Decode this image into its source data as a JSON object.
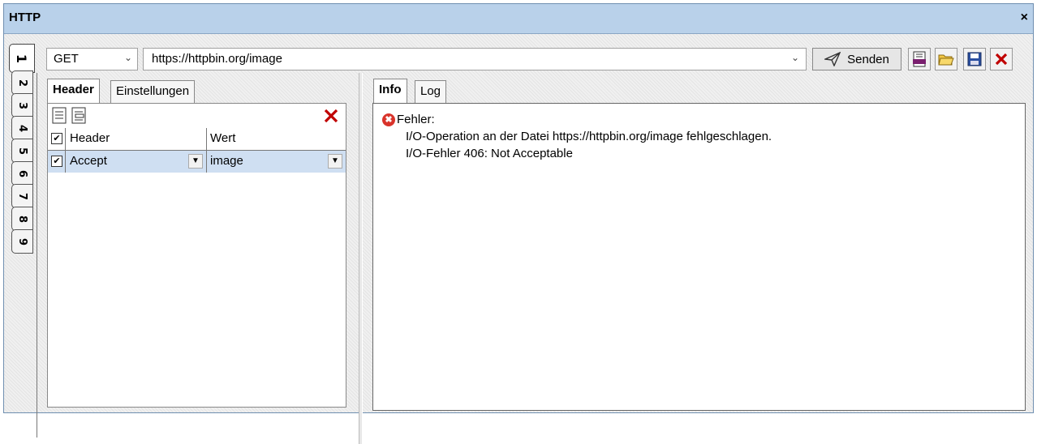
{
  "window": {
    "title": "HTTP",
    "close_glyph": "×"
  },
  "side_tabs": [
    "1",
    "2",
    "3",
    "4",
    "5",
    "6",
    "7",
    "8",
    "9"
  ],
  "request": {
    "method": "GET",
    "url": "https://httpbin.org/image",
    "send_label": "Senden"
  },
  "left_tabs": {
    "header": "Header",
    "settings": "Einstellungen"
  },
  "header_grid": {
    "columns": [
      "Header",
      "Wert"
    ],
    "rows": [
      {
        "checked": true,
        "header": "Accept",
        "value": "image"
      }
    ]
  },
  "right_tabs": {
    "info": "Info",
    "log": "Log"
  },
  "info": {
    "title": "Fehler:",
    "line1": "I/O-Operation an der Datei https://httpbin.org/image fehlgeschlagen.",
    "line2": "I/O-Fehler 406: Not Acceptable"
  },
  "colors": {
    "title_bar": "#b9d1ea",
    "selected_row": "#cfdff2",
    "error": "#d9342b",
    "delete": "#c00000"
  },
  "icons": [
    "send-icon",
    "wsdl-icon",
    "open-folder-icon",
    "save-icon",
    "close-request-icon",
    "append-row-icon",
    "insert-row-icon",
    "delete-row-icon",
    "error-icon"
  ]
}
